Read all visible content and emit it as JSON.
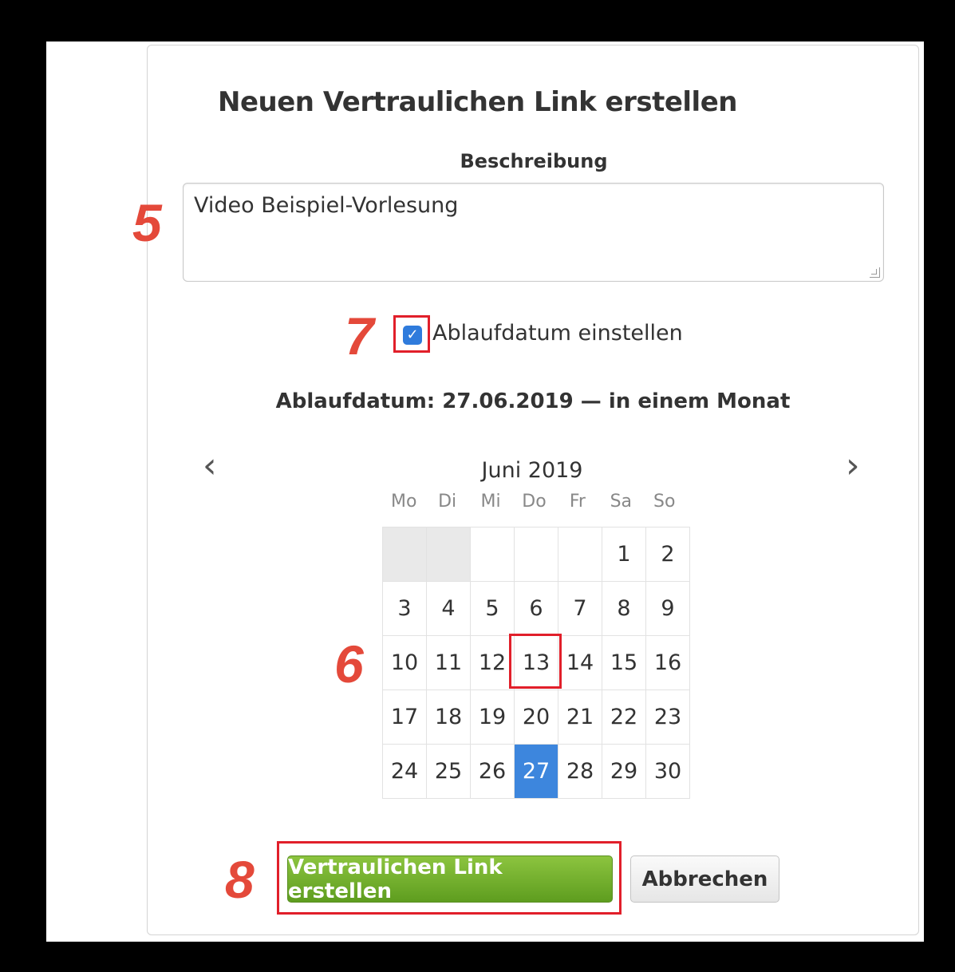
{
  "dialog": {
    "title": "Neuen Vertraulichen Link erstellen",
    "description_label": "Beschreibung",
    "description_value": "Video Beispiel-Vorlesung",
    "checkbox_label": "Ablaufdatum einstellen",
    "checkbox_checked": true,
    "expiry_text": "Ablaufdatum: 27.06.2019 — in einem Monat"
  },
  "calendar": {
    "month_label": "Juni 2019",
    "prev_icon": "chevron-left-icon",
    "next_icon": "chevron-right-icon",
    "weekdays": [
      "Mo",
      "Di",
      "Mi",
      "Do",
      "Fr",
      "Sa",
      "So"
    ],
    "weeks": [
      [
        "",
        "",
        "",
        "",
        "",
        "1",
        "2"
      ],
      [
        "3",
        "4",
        "5",
        "6",
        "7",
        "8",
        "9"
      ],
      [
        "10",
        "11",
        "12",
        "13",
        "14",
        "15",
        "16"
      ],
      [
        "17",
        "18",
        "19",
        "20",
        "21",
        "22",
        "23"
      ],
      [
        "24",
        "25",
        "26",
        "27",
        "28",
        "29",
        "30"
      ]
    ],
    "selected_day": "27",
    "selected_color": "#3d86dd"
  },
  "buttons": {
    "create_label": "Vertraulichen Link erstellen",
    "cancel_label": "Abbrechen",
    "create_color": "#6aab28"
  },
  "annotations": {
    "a5": "5",
    "a6": "6",
    "a7": "7",
    "a8": "8",
    "color": "#e4493a"
  }
}
